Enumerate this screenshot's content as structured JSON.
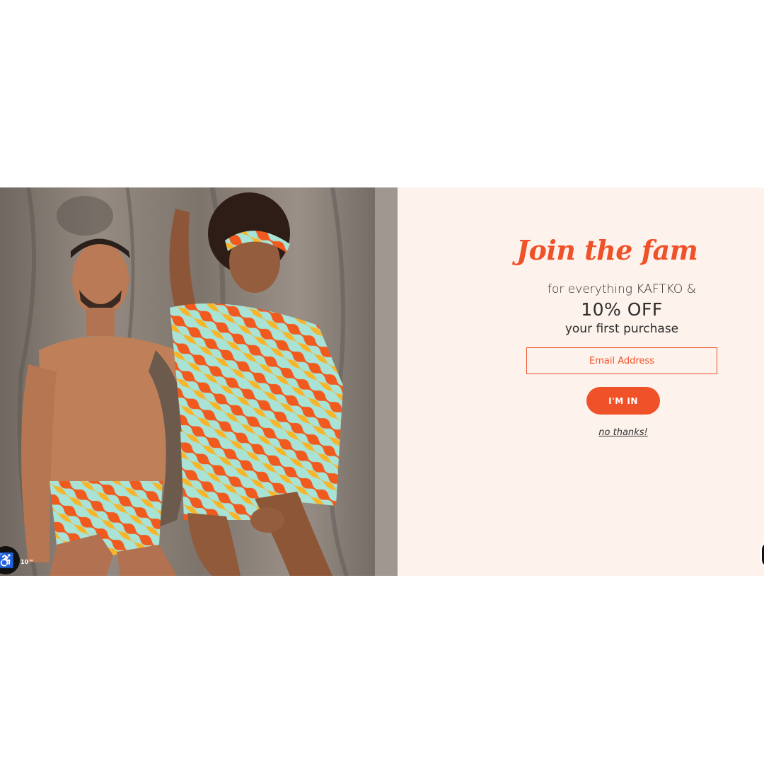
{
  "popup": {
    "headline": "Join the fam",
    "subtitle_line1": "for everything KAFTKO &",
    "subtitle_line2": "10% OFF",
    "subtitle_line3": "your first purchase",
    "email_placeholder": "Email Address",
    "cta_label": "I'M IN",
    "decline_label": "no thanks!"
  },
  "accessibility_widget": {
    "icon": "wheelchair-icon",
    "label": "10™"
  },
  "colors": {
    "accent": "#ef5128",
    "panel_bg": "#fdf2ec",
    "text": "#2c2c2c"
  }
}
